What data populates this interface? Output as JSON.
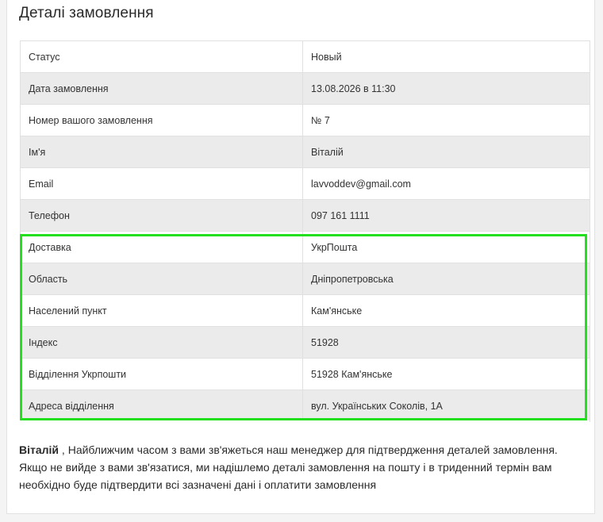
{
  "title": "Деталі замовлення",
  "rows": [
    {
      "label": "Статус",
      "value": "Новый"
    },
    {
      "label": "Дата замовлення",
      "value": "13.08.2026 в 11:30"
    },
    {
      "label": "Номер вашого замовлення",
      "value": "№ 7"
    },
    {
      "label": "Ім'я",
      "value": "Віталій"
    },
    {
      "label": "Email",
      "value": "lavvoddev@gmail.com"
    },
    {
      "label": "Телефон",
      "value": "097 161 1111"
    },
    {
      "label": "Доставка",
      "value": "УкрПошта"
    },
    {
      "label": "Область",
      "value": "Дніпропетровська"
    },
    {
      "label": "Населений пункт",
      "value": "Кам'янське"
    },
    {
      "label": "Індекс",
      "value": "51928"
    },
    {
      "label": "Відділення Укрпошти",
      "value": "51928 Кам'янське"
    },
    {
      "label": "Адреса відділення",
      "value": "вул. Українських Соколів, 1А"
    }
  ],
  "message": {
    "name": "Віталій",
    "text": " , Найближчим часом з вами зв'яжеться наш менеджер для підтвердження деталей замовлення. Якщо не вийде з вами зв'язатися, ми надішлемо деталі замовлення на пошту і в триденний термін вам необхідно буде підтвердити всі зазначені дані і оплатити замовлення"
  },
  "colors": {
    "highlight": "#22e01e",
    "row_alt": "#ebebeb"
  }
}
